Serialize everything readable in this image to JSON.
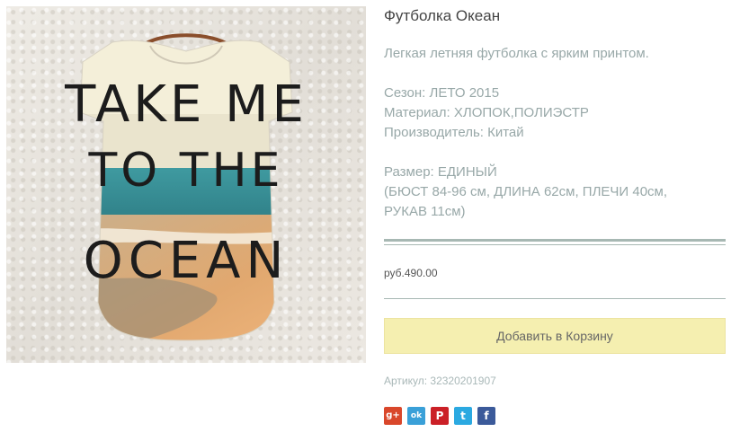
{
  "product": {
    "title": "Футболка Океан",
    "description": "Легкая летняя футболка с ярким принтом.",
    "season": "Сезон: ЛЕТО 2015",
    "material": "Материал: ХЛОПОК,ПОЛИЭСТР",
    "manufacturer": "Производитель: Китай",
    "size": "Размер: ЕДИНЫЙ",
    "size_detail_1": "(БЮСТ 84-96 см, ДЛИНА 62см, ПЛЕЧИ 40см,",
    "size_detail_2": "РУКАВ 11см)",
    "price": "руб.490.00",
    "add_to_cart": "Добавить в Корзину",
    "sku": "Артикул: 32320201907"
  },
  "print_text": {
    "line1": "TAKE ME",
    "line2": "TO THE",
    "line3": "OCEAN"
  },
  "social": {
    "google": "g+",
    "odnoklassniki": "ok",
    "pinterest": "P",
    "twitter": "t",
    "facebook": "f"
  },
  "colors": {
    "button_bg": "#f5efb0",
    "rule": "#a7b8b3",
    "muted_text": "#98a8a8"
  }
}
